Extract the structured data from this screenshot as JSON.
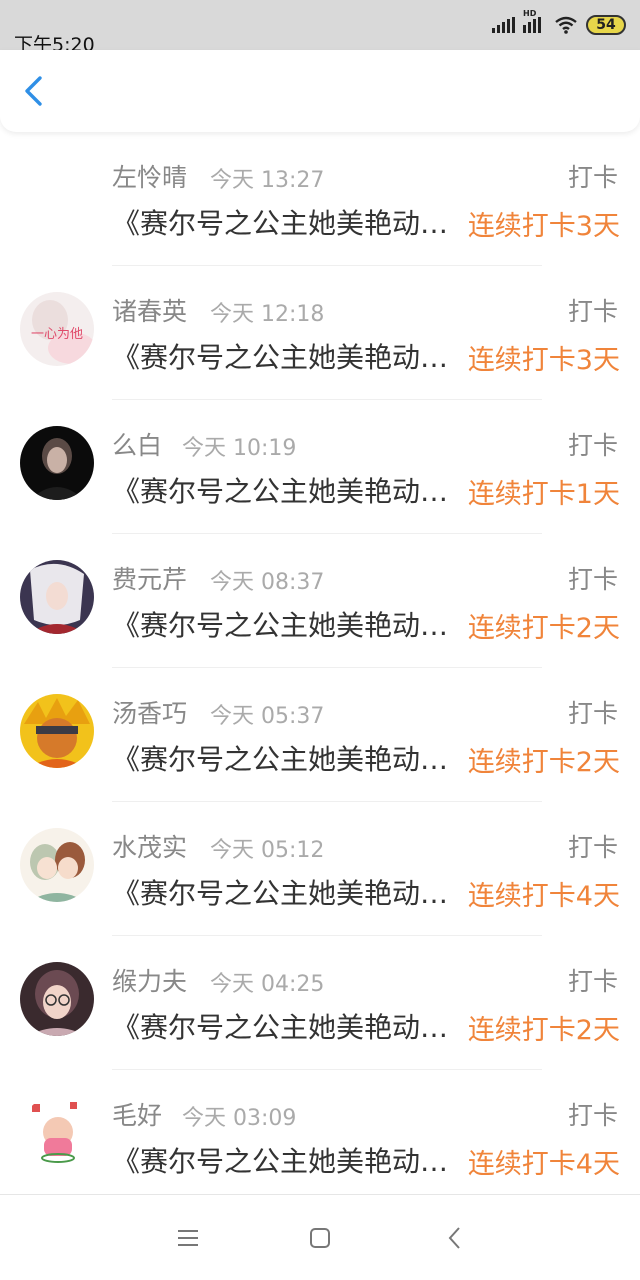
{
  "status_bar": {
    "time": "下午5:20",
    "battery": "54",
    "hd_label": "HD"
  },
  "header": {
    "back_icon": "chevron-left-icon"
  },
  "entries": [
    {
      "name": "左怜晴",
      "time": "今天 13:27",
      "type": "打卡",
      "title": "《赛尔号之公主她美艳动人》",
      "streak": "连续打卡3天",
      "avatar": "none"
    },
    {
      "name": "诸春英",
      "time": "今天 12:18",
      "type": "打卡",
      "title": "《赛尔号之公主她美艳动人》",
      "streak": "连续打卡3天",
      "avatar": "text-avatar",
      "avatar_text": "一心为他"
    },
    {
      "name": "么白",
      "time": "今天 10:19",
      "type": "打卡",
      "title": "《赛尔号之公主她美艳动人》",
      "streak": "连续打卡1天",
      "avatar": "dark-portrait"
    },
    {
      "name": "费元芹",
      "time": "今天 08:37",
      "type": "打卡",
      "title": "《赛尔号之公主她美艳动人》",
      "streak": "连续打卡2天",
      "avatar": "anime-white-hair"
    },
    {
      "name": "汤香巧",
      "time": "今天 05:37",
      "type": "打卡",
      "title": "《赛尔号之公主她美艳动人》",
      "streak": "连续打卡2天",
      "avatar": "anime-orange"
    },
    {
      "name": "水茂实",
      "time": "今天 05:12",
      "type": "打卡",
      "title": "《赛尔号之公主她美艳动人》",
      "streak": "连续打卡4天",
      "avatar": "anime-pair"
    },
    {
      "name": "缑力夫",
      "time": "今天 04:25",
      "type": "打卡",
      "title": "《赛尔号之公主她美艳动人》",
      "streak": "连续打卡2天",
      "avatar": "girl-glasses"
    },
    {
      "name": "毛好",
      "time": "今天 03:09",
      "type": "打卡",
      "title": "《赛尔号之公主她美艳动人》",
      "streak": "连续打卡4天",
      "avatar": "cartoon-pink"
    }
  ],
  "bottom_nav": {
    "menu_icon": "menu-icon",
    "home_icon": "home-square-icon",
    "back_icon": "back-triangle-icon"
  },
  "colors": {
    "accent": "#f0843a",
    "back_arrow": "#2f8fe6",
    "status_bar_bg": "#d9d9d9"
  }
}
